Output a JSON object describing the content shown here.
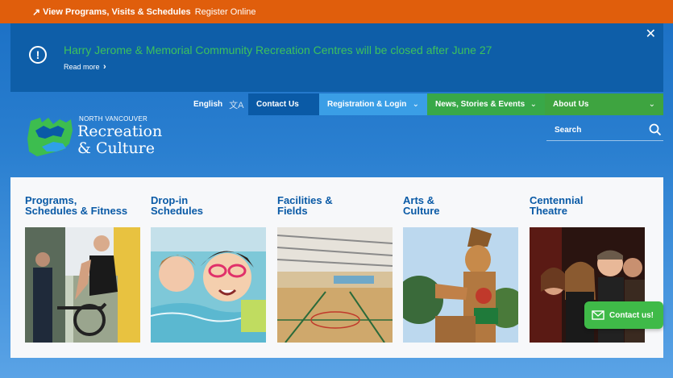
{
  "topbar": {
    "arrow_icon": "↗",
    "programs_link": "View Programs, Visits & Schedules",
    "register_link": "Register Online"
  },
  "alert": {
    "message": "Harry Jerome & Memorial Community Recreation Centres will be closed after June 27",
    "read_more": "Read more",
    "read_more_arrow": "›",
    "close": "✕",
    "info_glyph": "!"
  },
  "nav": {
    "language": "English",
    "language_icon": "文A",
    "contact": "Contact Us",
    "registration": "Registration & Login",
    "news": "News, Stories & Events",
    "about": "About Us",
    "chevron": "⌄"
  },
  "logo": {
    "small": "NORTH VANCOUVER",
    "line1": "Recreation",
    "line2": "& Culture"
  },
  "search": {
    "label": "Search"
  },
  "cards": [
    {
      "line1": "Programs,",
      "line2": "Schedules & Fitness"
    },
    {
      "line1": "Drop-in",
      "line2": "Schedules"
    },
    {
      "line1": "Facilities &",
      "line2": "Fields"
    },
    {
      "line1": "Arts &",
      "line2": "Culture"
    },
    {
      "line1": "Centennial",
      "line2": "Theatre"
    }
  ],
  "contact_button": {
    "label": "Contact us!"
  },
  "colors": {
    "topbar": "#e05e0c",
    "alert_bg": "#0e5ea8",
    "alert_text": "#3dc25c",
    "nav_contact": "#0a5aa6",
    "nav_registration": "#3a9ee6",
    "nav_news": "#38a848",
    "nav_about": "#3ea440",
    "card_title": "#0a5aa6",
    "contact_button": "#3fba48"
  }
}
